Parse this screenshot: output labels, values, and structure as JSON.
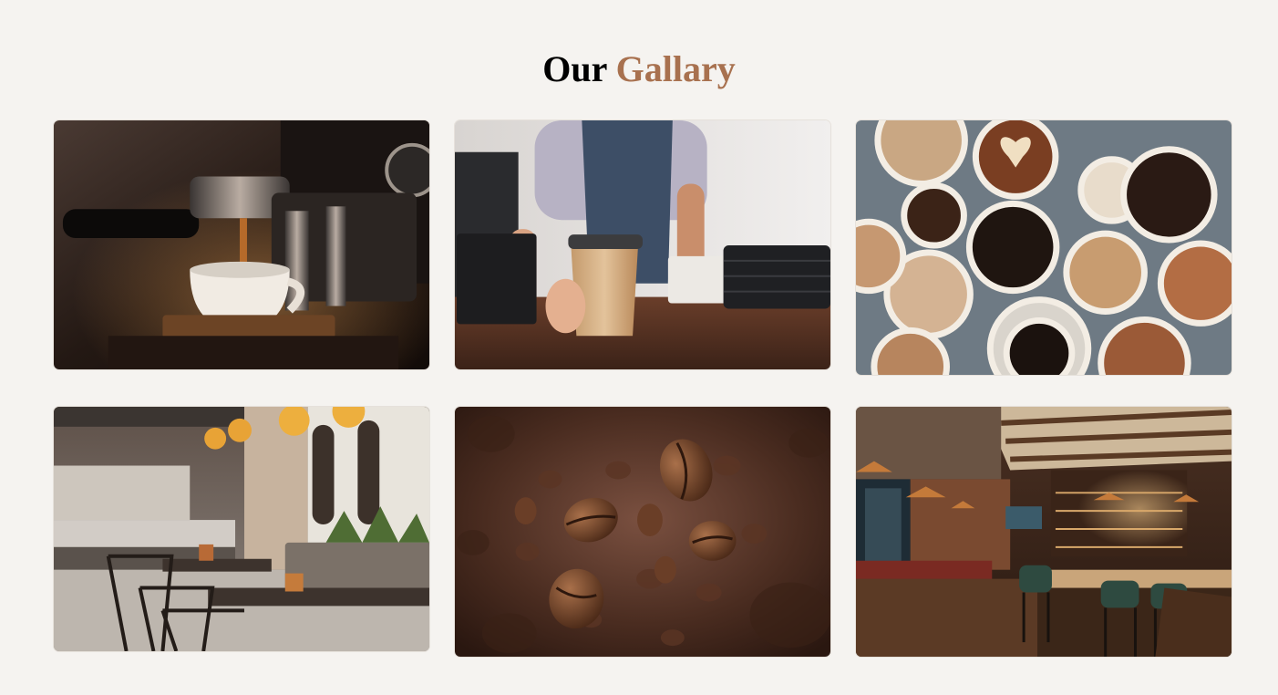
{
  "header": {
    "title_main": "Our",
    "title_accent": "Gallary",
    "accent_color": "#a8714f"
  },
  "gallery": {
    "images": [
      {
        "subject": "espresso-machine-pouring-coffee"
      },
      {
        "subject": "barista-serving-takeaway-cup"
      },
      {
        "subject": "top-view-assorted-coffee-cups"
      },
      {
        "subject": "modern-cafe-interior"
      },
      {
        "subject": "floating-coffee-beans"
      },
      {
        "subject": "rustic-bar-interior"
      }
    ]
  }
}
